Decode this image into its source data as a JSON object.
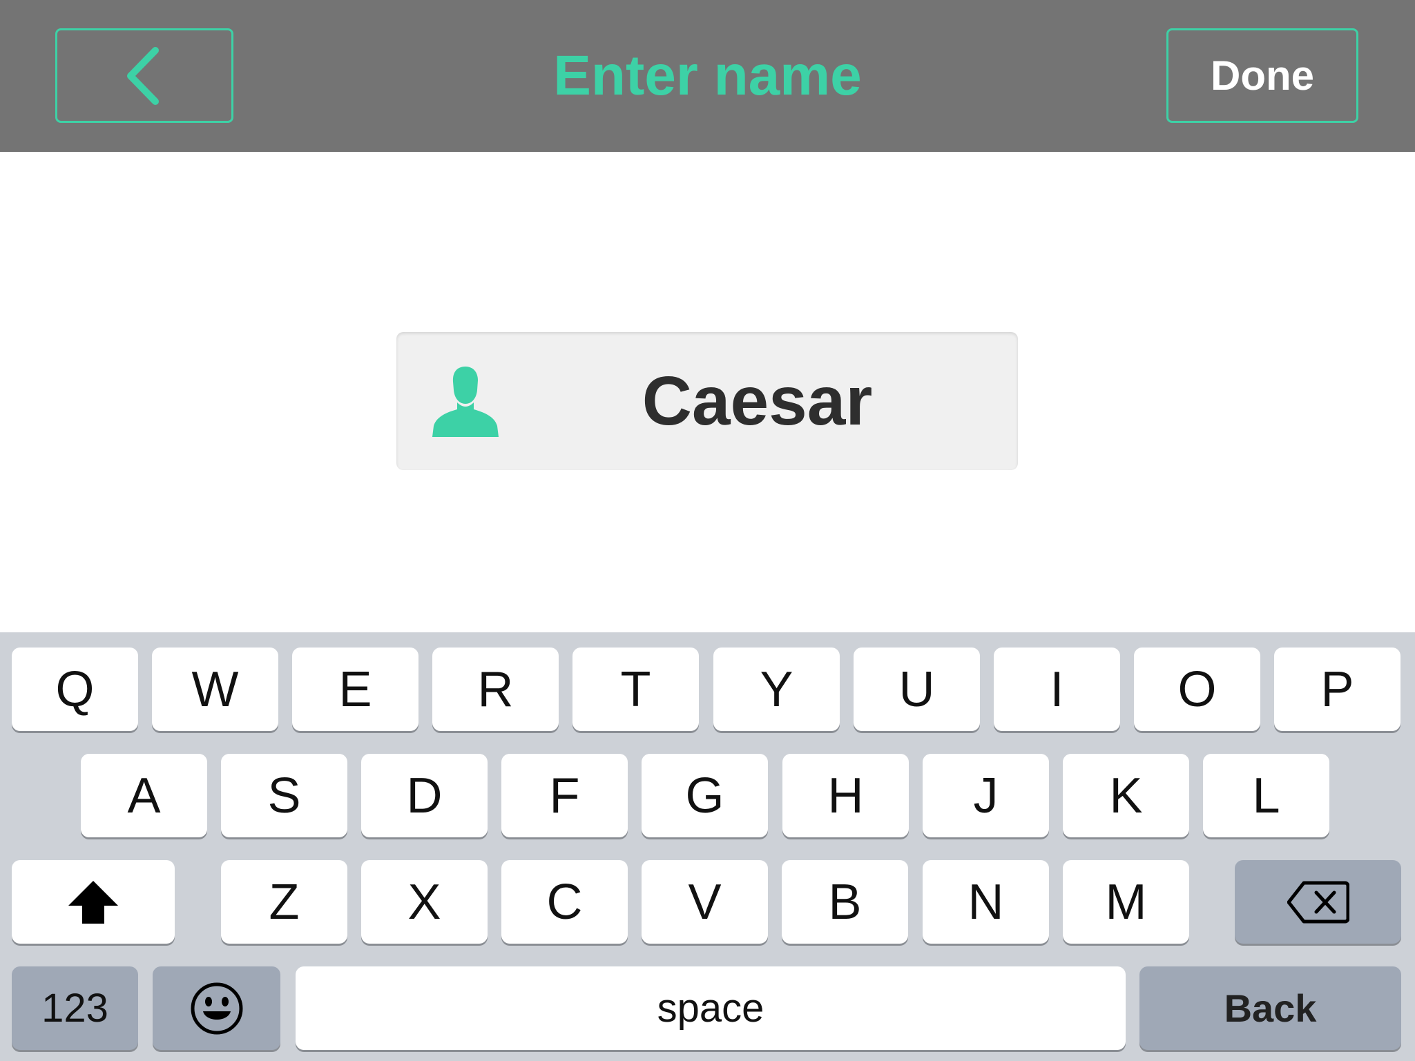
{
  "header": {
    "title": "Enter name",
    "done_label": "Done",
    "back_icon": "chevron-left-icon"
  },
  "name_field": {
    "icon": "person-icon",
    "value": "Caesar"
  },
  "keyboard": {
    "row1": [
      "Q",
      "W",
      "E",
      "R",
      "T",
      "Y",
      "U",
      "I",
      "O",
      "P"
    ],
    "row2": [
      "A",
      "S",
      "D",
      "F",
      "G",
      "H",
      "J",
      "K",
      "L"
    ],
    "row3": [
      "Z",
      "X",
      "C",
      "V",
      "B",
      "N",
      "M"
    ],
    "shift_icon": "shift-arrow-icon",
    "delete_icon": "backspace-icon",
    "numbers_label": "123",
    "emoji_icon": "emoji-smiley-icon",
    "space_label": "space",
    "return_label": "Back"
  },
  "colors": {
    "accent": "#3dd1a6",
    "header_bg": "#747474",
    "keyboard_bg": "#cdd1d7",
    "dark_key": "#9fa8b6"
  }
}
